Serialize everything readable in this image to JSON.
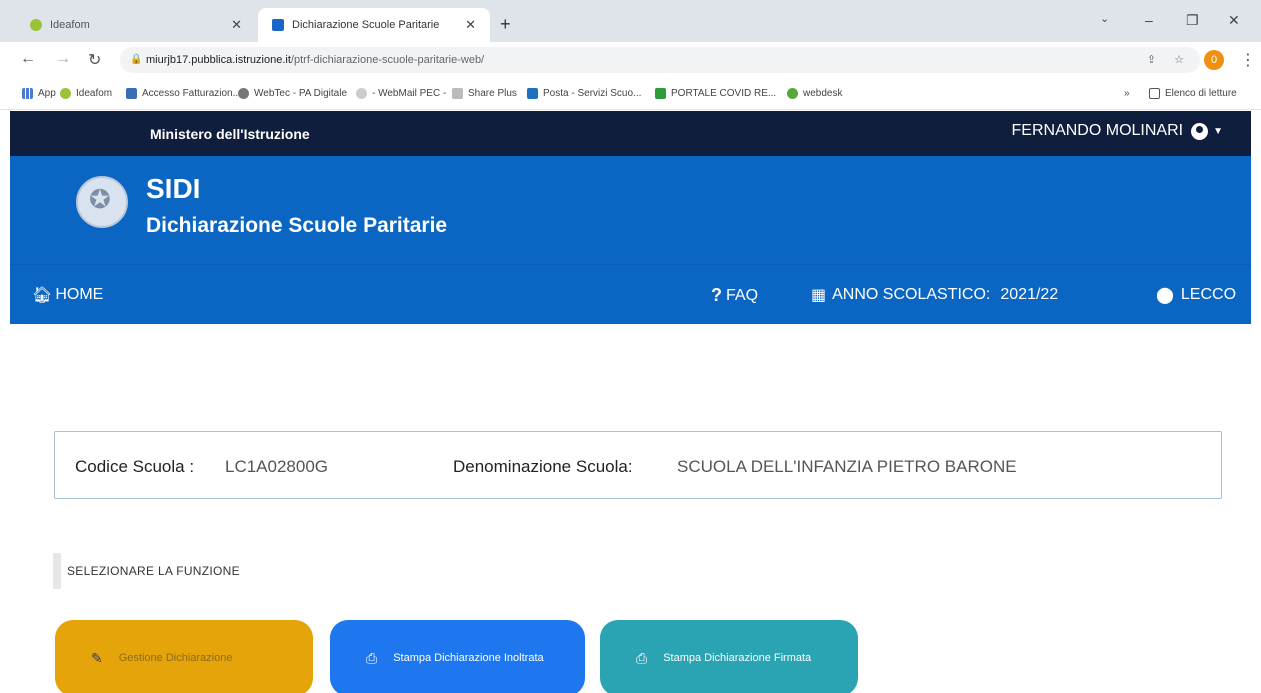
{
  "browser": {
    "tabs": [
      {
        "title": "Ideafom"
      },
      {
        "title": "Dichiarazione Scuole Paritarie"
      }
    ],
    "address": {
      "host": "miurjb17.pubblica.istruzione.it",
      "path": "/ptrf-dichiarazione-scuole-paritarie-web/"
    },
    "profile_initial": "0",
    "bookmarks": [
      "App",
      "Ideafom",
      "Accesso Fatturazion...",
      "WebTec - PA Digitale",
      "- WebMail PEC -",
      "Share Plus",
      "Posta - Servizi Scuo...",
      "PORTALE COVID RE...",
      "webdesk",
      "Elenco di letture"
    ]
  },
  "site": {
    "ministero": "Ministero dell'Istruzione",
    "user_name": "FERNANDO MOLINARI",
    "app_name": "SIDI",
    "app_subtitle": "Dichiarazione Scuole Paritarie",
    "nav": {
      "home": "HOME",
      "faq": "FAQ",
      "anno_label": "ANNO SCOLASTICO:",
      "anno_value": "2021/22",
      "location": "LECCO"
    },
    "school": {
      "codice_label": "Codice Scuola :",
      "codice_value": "LC1A02800G",
      "denominazione_label": "Denominazione Scuola:",
      "denominazione_value": "SCUOLA DELL'INFANZIA PIETRO BARONE"
    },
    "select_label": "SELEZIONARE LA FUNZIONE",
    "buttons": {
      "gestione": "Gestione Dichiarazione",
      "stampa_inoltrata": "Stampa Dichiarazione Inoltrata",
      "stampa_firmata": "Stampa Dichiarazione Firmata"
    }
  },
  "colors": {
    "top_strip": "#0e1e3c",
    "header_blue": "#0a66c2",
    "btn_gestione": "#e5a50a",
    "btn_inoltrata": "#1f77f0",
    "btn_firmata": "#2aa3b2"
  }
}
